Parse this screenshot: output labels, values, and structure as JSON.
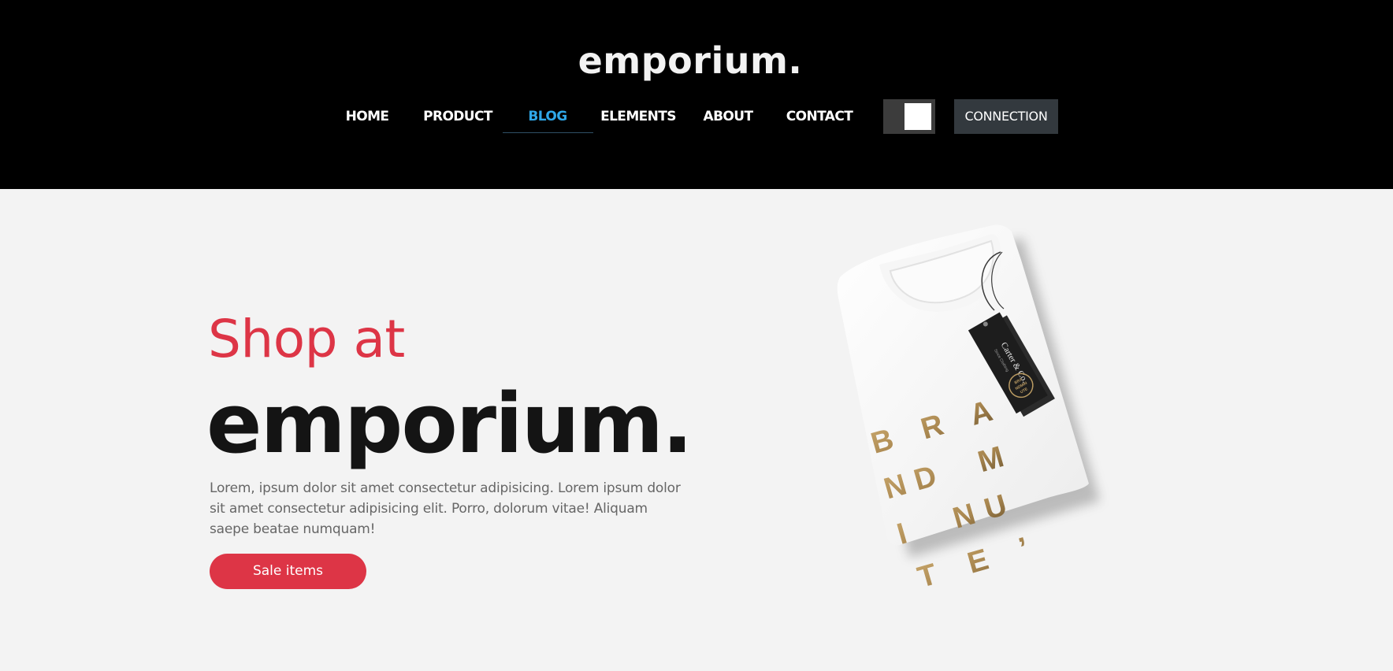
{
  "brand": {
    "logo": "emporium."
  },
  "nav": {
    "items": [
      {
        "label": "HOME"
      },
      {
        "label": "PRODUCT"
      },
      {
        "label": "BLOG"
      },
      {
        "label": "ELEMENTS"
      },
      {
        "label": "ABOUT"
      },
      {
        "label": "CONTACT"
      }
    ],
    "active": "BLOG",
    "theme_toggle_on": true,
    "connection_label": "CONNECTION"
  },
  "hero": {
    "kicker": "Shop at",
    "title": "emporium.",
    "text": "Lorem, ipsum dolor sit amet consectetur adipisicing. Lorem ipsum dolor sit amet consectetur adipisicing elit. Porro, dolorum vitae! Aliquam saepe beatae numquam!",
    "cta_label": "Sale items"
  },
  "product_image": {
    "tag_brand": "Carter & Co.",
    "tag_sub": "Since Clothing",
    "tag_seal_lines": [
      "BRA",
      "NDMIN",
      "UTE"
    ],
    "print_lines": [
      "B R A",
      "ND  M",
      "I  NU",
      "T E ’"
    ]
  },
  "colors": {
    "header_bg": "#000000",
    "page_bg": "#f3f3f3",
    "accent_red": "#dd3546",
    "active_nav": "#2fa7e8",
    "connection_bg": "#33393e",
    "print_gold": "#b99a62"
  }
}
